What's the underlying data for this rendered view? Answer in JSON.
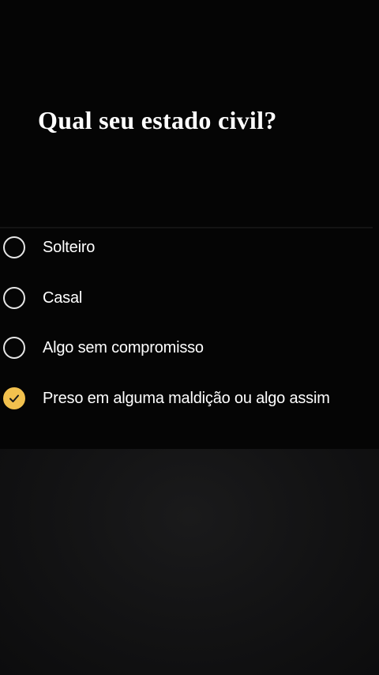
{
  "question": {
    "title": "Qual seu estado civil?"
  },
  "options": [
    {
      "label": "Solteiro",
      "selected": false
    },
    {
      "label": "Casal",
      "selected": false
    },
    {
      "label": "Algo sem compromisso",
      "selected": false
    },
    {
      "label": "Preso em alguma maldição ou algo assim",
      "selected": true
    }
  ],
  "colors": {
    "accent": "#f2c14e",
    "background": "#000000",
    "text": "#ffffff"
  }
}
